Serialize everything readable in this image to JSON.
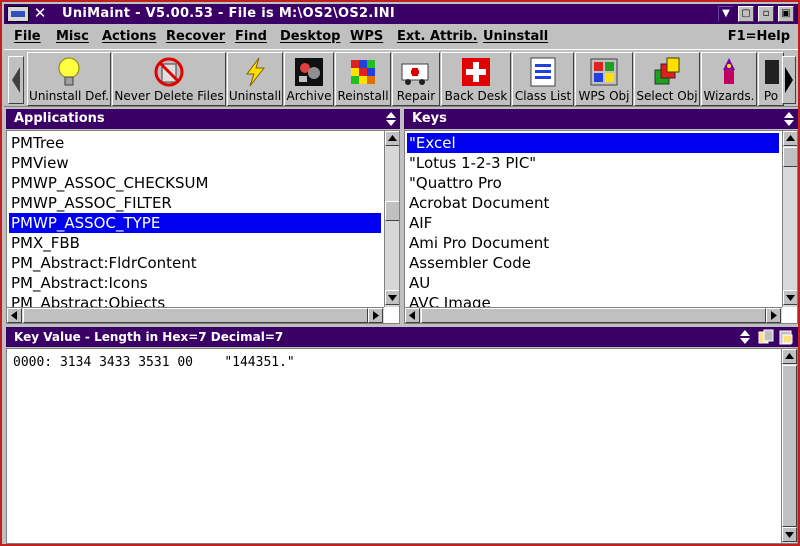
{
  "window": {
    "title": "UniMaint - V5.00.53 - File is M:\\OS2\\OS2.INI",
    "close_glyph": "✕",
    "btn_down": "▼",
    "btn_hide": "▢",
    "btn_min": "▫",
    "btn_max": "▣"
  },
  "menu": {
    "items": [
      "File",
      "Misc",
      "Actions",
      "Recover",
      "Find",
      "Desktop",
      "WPS",
      "Ext. Attrib.",
      "Uninstall"
    ],
    "help": "F1=Help"
  },
  "toolbar": {
    "tools": [
      {
        "label": "Uninstall Def.",
        "icon": "lightbulb-icon"
      },
      {
        "label": "Never Delete Files",
        "icon": "no-delete-icon"
      },
      {
        "label": "Uninstall",
        "icon": "lightning-icon"
      },
      {
        "label": "Archive",
        "icon": "archive-icon"
      },
      {
        "label": "Reinstall",
        "icon": "cube-icon"
      },
      {
        "label": "Repair",
        "icon": "ambulance-icon"
      },
      {
        "label": "Back Desk",
        "icon": "red-cross-icon"
      },
      {
        "label": "Class List",
        "icon": "class-list-icon"
      },
      {
        "label": "WPS Obj",
        "icon": "wps-object-icon"
      },
      {
        "label": "Select Obj",
        "icon": "select-object-icon"
      },
      {
        "label": "Wizards.",
        "icon": "wizard-icon"
      },
      {
        "label": "Po",
        "icon": "partial-icon"
      }
    ]
  },
  "applications": {
    "title": "Applications",
    "items": [
      "PMTree",
      "PMView",
      "PMWP_ASSOC_CHECKSUM",
      "PMWP_ASSOC_FILTER",
      "PMWP_ASSOC_TYPE",
      "PMX_FBB",
      "PM_Abstract:FldrContent",
      "PM_Abstract:Icons",
      "PM_Abstract:Objects"
    ],
    "selected": "PMWP_ASSOC_TYPE"
  },
  "keys": {
    "title": "Keys",
    "items": [
      "\"Excel",
      "\"Lotus 1-2-3 PIC\"",
      "\"Quattro Pro",
      "Acrobat Document",
      "AIF",
      "Ami Pro Document",
      "Assembler Code",
      "AU",
      "AVC Image"
    ],
    "selected": "\"Excel"
  },
  "key_value": {
    "title": "Key Value - Length in Hex=7 Decimal=7",
    "line": "0000: 3134 3433 3531 00    \"144351.\""
  },
  "colors": {
    "title_bg": "#3b0066",
    "selection": "#0000f0",
    "frame": "#c02020"
  }
}
